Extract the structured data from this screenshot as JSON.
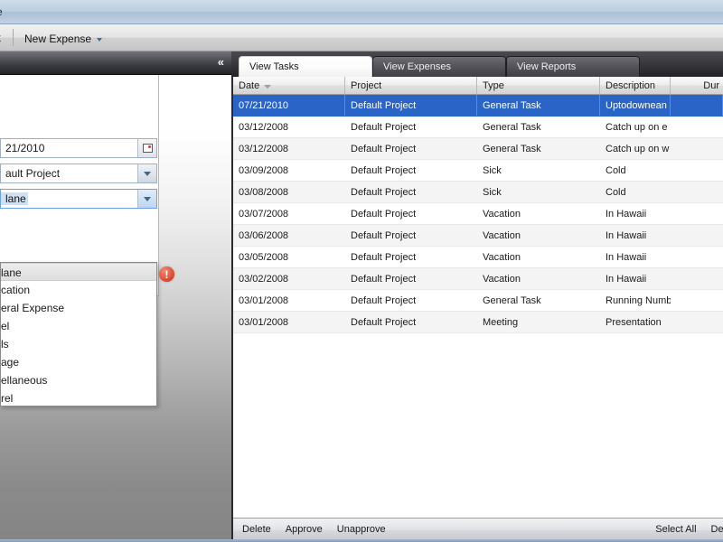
{
  "window": {
    "title_fragment": "e"
  },
  "toolbar": {
    "prev_fragment": "k",
    "new_expense_label": "New Expense",
    "caret_icon": "caret-down-icon"
  },
  "left_panel": {
    "collapse_label": "«",
    "fields": [
      {
        "name": "date",
        "value": "21/2010",
        "button_icon": "calendar-icon"
      },
      {
        "name": "project",
        "value": "ault Project",
        "button_icon": "chevron-down-icon"
      },
      {
        "name": "type",
        "value": "lane",
        "button_icon": "chevron-down-icon",
        "focused": true
      }
    ],
    "dropdown": {
      "items": [
        "lane",
        "cation",
        "eral Expense",
        "el",
        "ls",
        "age",
        "ellaneous",
        "rel"
      ],
      "highlighted_index": 0
    },
    "error_icon": {
      "name": "error-icon",
      "glyph": "!",
      "color": "#e2543a"
    }
  },
  "tabs": [
    {
      "label": "View Tasks",
      "active": true
    },
    {
      "label": "View Expenses",
      "active": false
    },
    {
      "label": "View Reports",
      "active": false
    }
  ],
  "grid": {
    "columns": [
      {
        "label": "Date",
        "sorted": "desc",
        "class": "c-date"
      },
      {
        "label": "Project",
        "sorted": "",
        "class": "c-proj"
      },
      {
        "label": "Type",
        "sorted": "",
        "class": "c-type"
      },
      {
        "label": "Description",
        "sorted": "",
        "class": "c-desc"
      },
      {
        "label": "Dur",
        "sorted": "",
        "class": "c-dur"
      }
    ],
    "rows": [
      {
        "date": "07/21/2010",
        "project": "Default Project",
        "type": "General Task",
        "description": "Uptodownean",
        "duration": "",
        "selected": true
      },
      {
        "date": "03/12/2008",
        "project": "Default Project",
        "type": "General Task",
        "description": "Catch up on e",
        "duration": "",
        "selected": false
      },
      {
        "date": "03/12/2008",
        "project": "Default Project",
        "type": "General Task",
        "description": "Catch up on w",
        "duration": "",
        "selected": false
      },
      {
        "date": "03/09/2008",
        "project": "Default Project",
        "type": "Sick",
        "description": "Cold",
        "duration": "",
        "selected": false
      },
      {
        "date": "03/08/2008",
        "project": "Default Project",
        "type": "Sick",
        "description": "Cold",
        "duration": "",
        "selected": false
      },
      {
        "date": "03/07/2008",
        "project": "Default Project",
        "type": "Vacation",
        "description": "In Hawaii",
        "duration": "",
        "selected": false
      },
      {
        "date": "03/06/2008",
        "project": "Default Project",
        "type": "Vacation",
        "description": "In Hawaii",
        "duration": "",
        "selected": false
      },
      {
        "date": "03/05/2008",
        "project": "Default Project",
        "type": "Vacation",
        "description": "In Hawaii",
        "duration": "",
        "selected": false
      },
      {
        "date": "03/02/2008",
        "project": "Default Project",
        "type": "Vacation",
        "description": "In Hawaii",
        "duration": "",
        "selected": false
      },
      {
        "date": "03/01/2008",
        "project": "Default Project",
        "type": "General Task",
        "description": "Running Numb",
        "duration": "",
        "selected": false
      },
      {
        "date": "03/01/2008",
        "project": "Default Project",
        "type": "Meeting",
        "description": "Presentation",
        "duration": "",
        "selected": false
      }
    ]
  },
  "bottom_toolbar": {
    "left_actions": [
      "Delete",
      "Approve",
      "Unapprove"
    ],
    "right_actions": [
      "Select All",
      "Deselect All"
    ]
  },
  "colors": {
    "selection_blue": "#2a64c6",
    "title_blue": "#bdcfe1",
    "error_red": "#e2543a",
    "panel_dark": "#2b2b2f"
  }
}
